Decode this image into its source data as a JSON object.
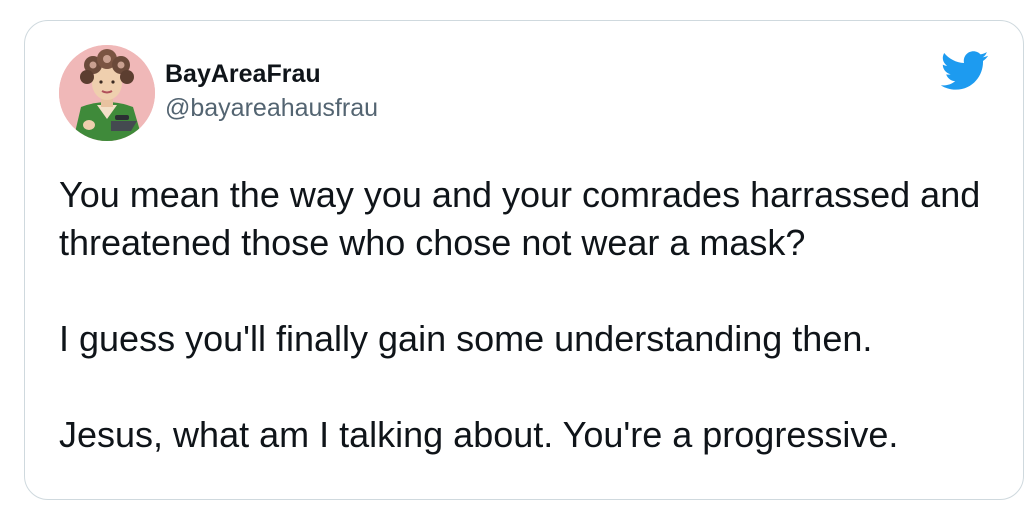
{
  "tweet": {
    "author": {
      "display_name": "BayAreaFrau",
      "handle": "@bayareahausfrau",
      "avatar_icon": "profile-photo"
    },
    "brand_icon": "twitter-bird-icon",
    "brand_color": "#1d9bf0",
    "text_paragraphs": [
      "You mean the way you and your comrades harrassed and threatened those who chose not wear a mask?",
      "I guess you'll finally gain some understanding then.",
      "Jesus, what am I talking about. You're a progressive."
    ]
  }
}
